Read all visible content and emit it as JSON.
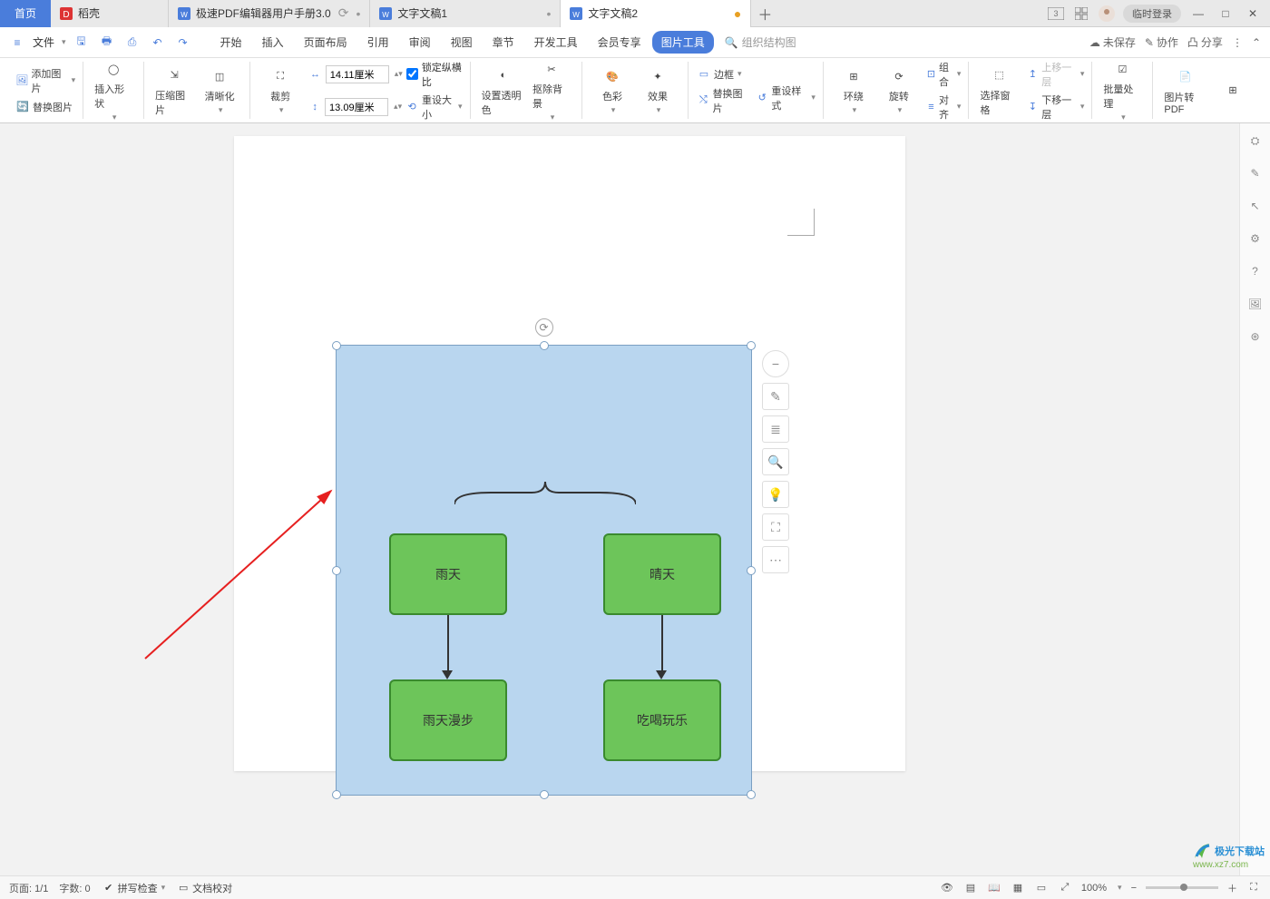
{
  "topbar": {
    "home": "首页",
    "tabs": [
      {
        "label": "稻壳",
        "type": "dk"
      },
      {
        "label": "极速PDF编辑器用户手册3.0",
        "type": "doc"
      },
      {
        "label": "文字文稿1",
        "type": "doc"
      },
      {
        "label": "文字文稿2",
        "type": "doc",
        "active": true,
        "dirty": true
      }
    ],
    "login": "临时登录"
  },
  "menubar": {
    "file": "文件",
    "tabs": [
      "开始",
      "插入",
      "页面布局",
      "引用",
      "审阅",
      "视图",
      "章节",
      "开发工具",
      "会员专享"
    ],
    "pic_tool": "图片工具",
    "org": "组织结构图",
    "right": {
      "unsaved": "未保存",
      "coop": "协作",
      "share": "分享"
    }
  },
  "ribbon": {
    "add_img": "添加图片",
    "replace_img": "替换图片",
    "insert_shape": "插入形状",
    "compress": "压缩图片",
    "clarity": "清晰化",
    "crop": "裁剪",
    "width": "14.11厘米",
    "height": "13.09厘米",
    "lock": "锁定纵横比",
    "reset_size": "重设大小",
    "set_trans": "设置透明色",
    "remove_bg": "抠除背景",
    "color": "色彩",
    "effect": "效果",
    "border": "边框",
    "replace_img2": "替换图片",
    "reset_style": "重设样式",
    "wrap": "环绕",
    "rotate": "旋转",
    "group": "组合",
    "align": "对齐",
    "sel_pane": "选择窗格",
    "up_layer": "上移一层",
    "down_layer": "下移一层",
    "batch": "批量处理",
    "to_pdf": "图片转PDF"
  },
  "flow": {
    "b1": "雨天",
    "b2": "晴天",
    "b3": "雨天漫步",
    "b4": "吃喝玩乐"
  },
  "status": {
    "page": "页面: 1/1",
    "words": "字数: 0",
    "spell": "拼写检查",
    "proof": "文档校对",
    "zoom": "100%"
  },
  "watermark": {
    "name": "极光下载站",
    "url": "www.xz7.com"
  }
}
